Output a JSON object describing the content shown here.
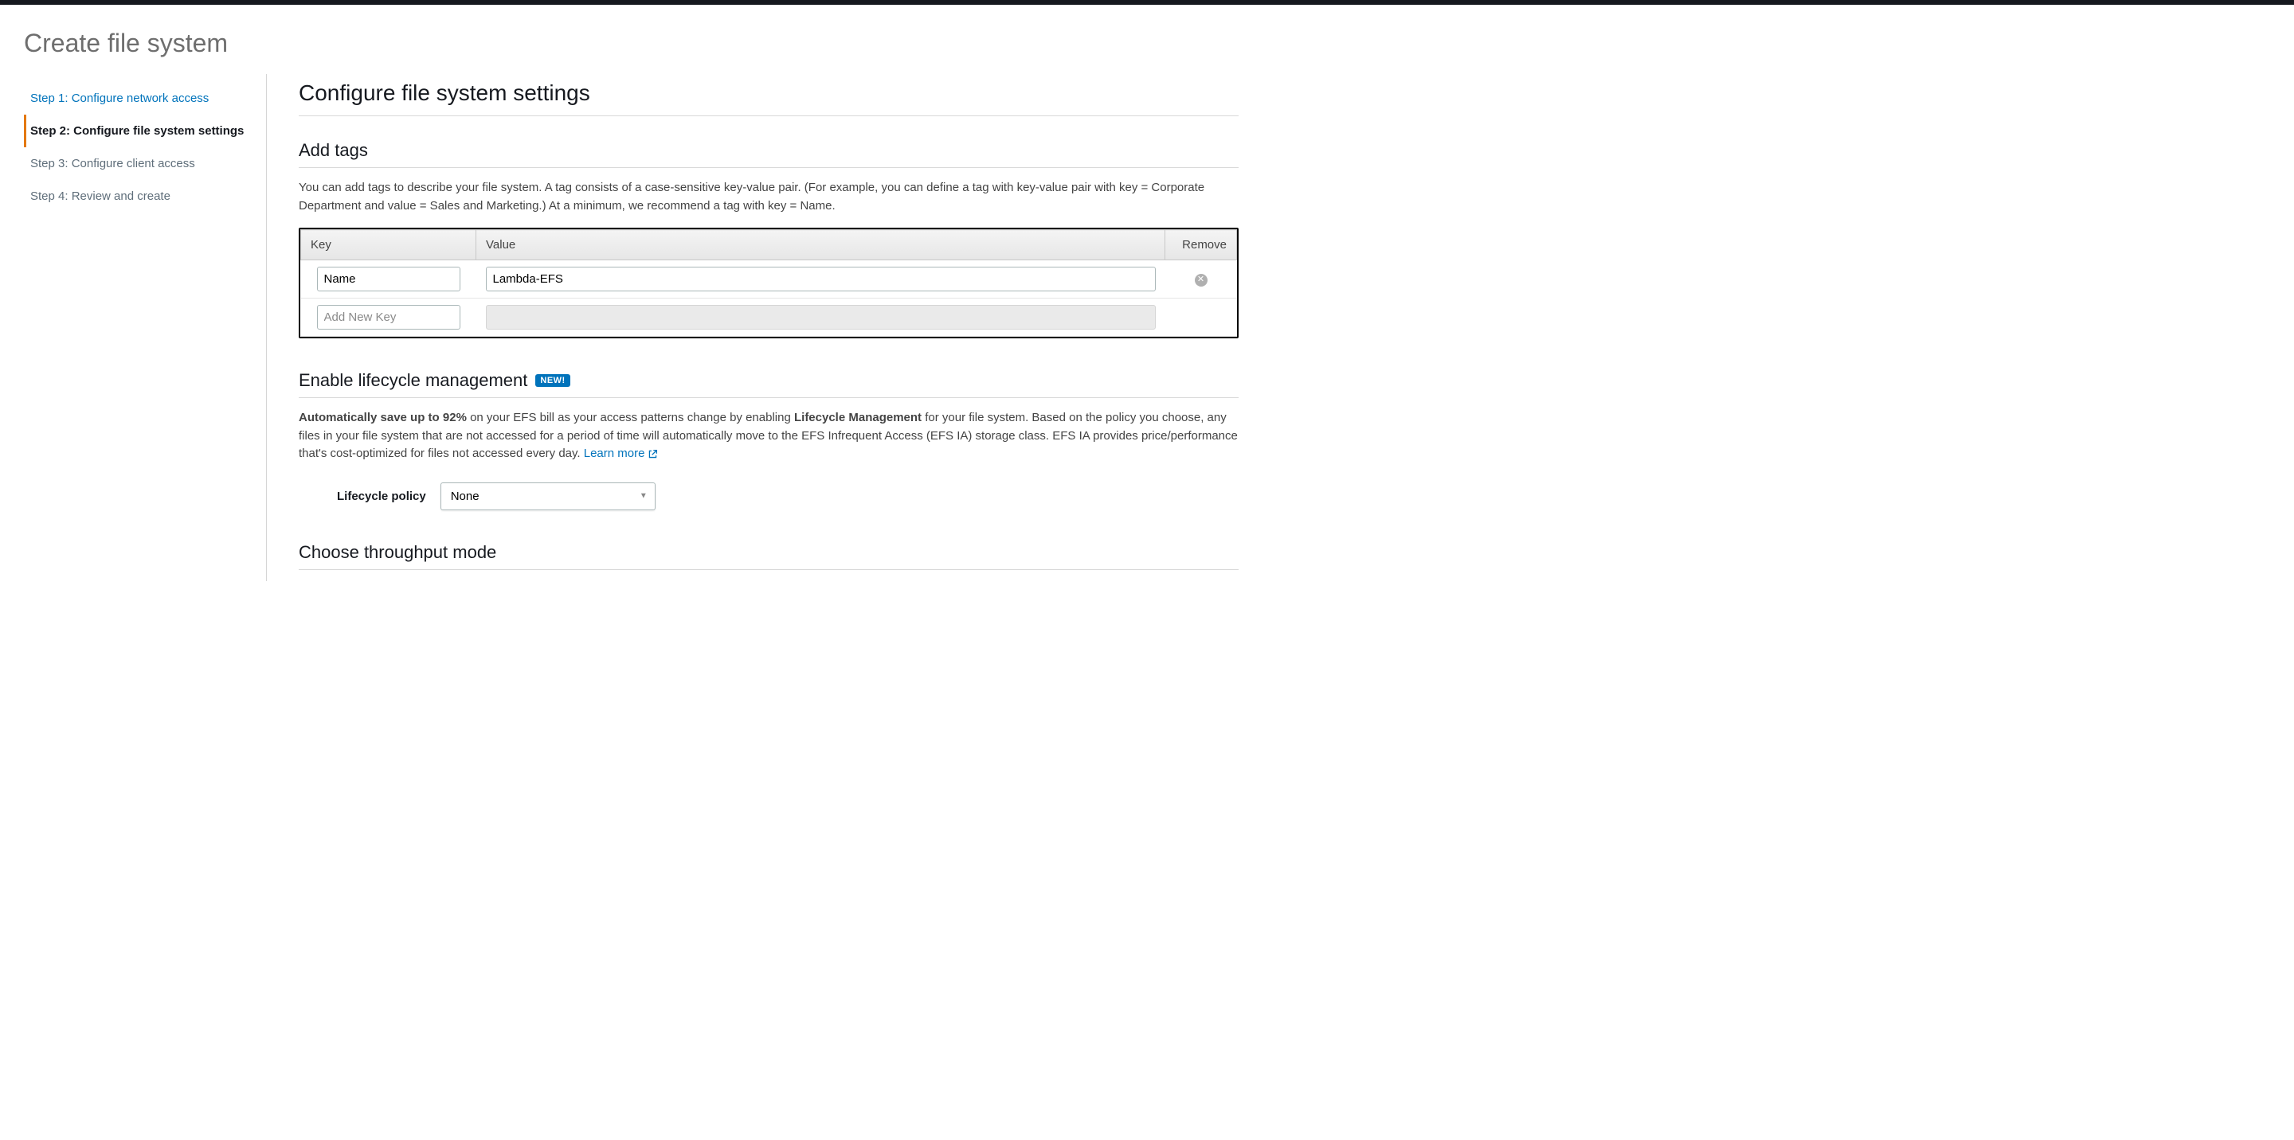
{
  "page_title": "Create file system",
  "sidebar": {
    "steps": [
      {
        "label": "Step 1: Configure network access",
        "state": "completed"
      },
      {
        "label": "Step 2: Configure file system settings",
        "state": "active"
      },
      {
        "label": "Step 3: Configure client access",
        "state": "upcoming"
      },
      {
        "label": "Step 4: Review and create",
        "state": "upcoming"
      }
    ]
  },
  "main": {
    "section_title": "Configure file system settings",
    "tags": {
      "title": "Add tags",
      "description": "You can add tags to describe your file system. A tag consists of a case-sensitive key-value pair. (For example, you can define a tag with key-value pair with key = Corporate Department and value = Sales and Marketing.) At a minimum, we recommend a tag with key = Name.",
      "headers": {
        "key": "Key",
        "value": "Value",
        "remove": "Remove"
      },
      "rows": [
        {
          "key": "Name",
          "value": "Lambda-EFS",
          "removable": true
        },
        {
          "key_placeholder": "Add New Key",
          "value_disabled": true
        }
      ]
    },
    "lifecycle": {
      "title": "Enable lifecycle management",
      "badge": "NEW!",
      "desc_pre_bold": "Automatically save up to 92%",
      "desc_mid1": " on your EFS bill as your access patterns change by enabling ",
      "desc_bold2": "Lifecycle Management",
      "desc_mid2": " for your file system. Based on the policy you choose, any files in your file system that are not accessed for a period of time will automatically move to the EFS Infrequent Access (EFS IA) storage class. EFS IA provides price/performance that's cost-optimized for files not accessed every day. ",
      "learn_more": "Learn more",
      "policy_label": "Lifecycle policy",
      "policy_value": "None"
    },
    "throughput": {
      "title": "Choose throughput mode"
    }
  }
}
